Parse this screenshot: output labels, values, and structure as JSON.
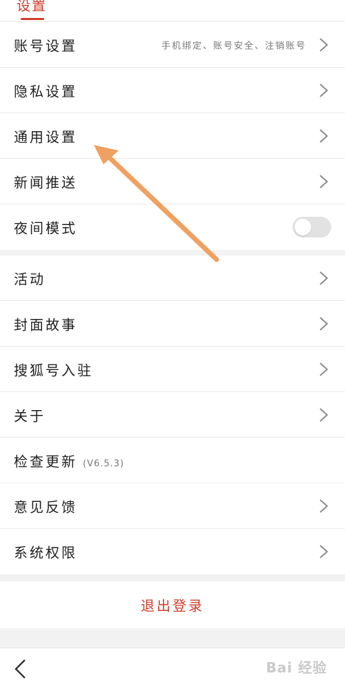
{
  "header": {
    "title": "设置"
  },
  "group1": [
    {
      "label": "账号设置",
      "sub": "手机绑定、账号安全、注销账号"
    },
    {
      "label": "隐私设置"
    },
    {
      "label": "通用设置"
    },
    {
      "label": "新闻推送"
    },
    {
      "label": "夜间模式",
      "toggle": "off"
    }
  ],
  "group2": [
    {
      "label": "活动"
    },
    {
      "label": "封面故事"
    },
    {
      "label": "搜狐号入驻"
    },
    {
      "label": "关于"
    },
    {
      "label": "检查更新",
      "version": "(V6.5.3)"
    },
    {
      "label": "意见反馈"
    },
    {
      "label": "系统权限"
    }
  ],
  "logout": {
    "label": "退出登录"
  },
  "watermark": {
    "text": "Bai 经验"
  },
  "colors": {
    "accent": "#d23b2a",
    "arrow": "#f0a060"
  },
  "icons": [
    "chevron-right-icon",
    "back-arrow-icon",
    "toggle-switch"
  ]
}
